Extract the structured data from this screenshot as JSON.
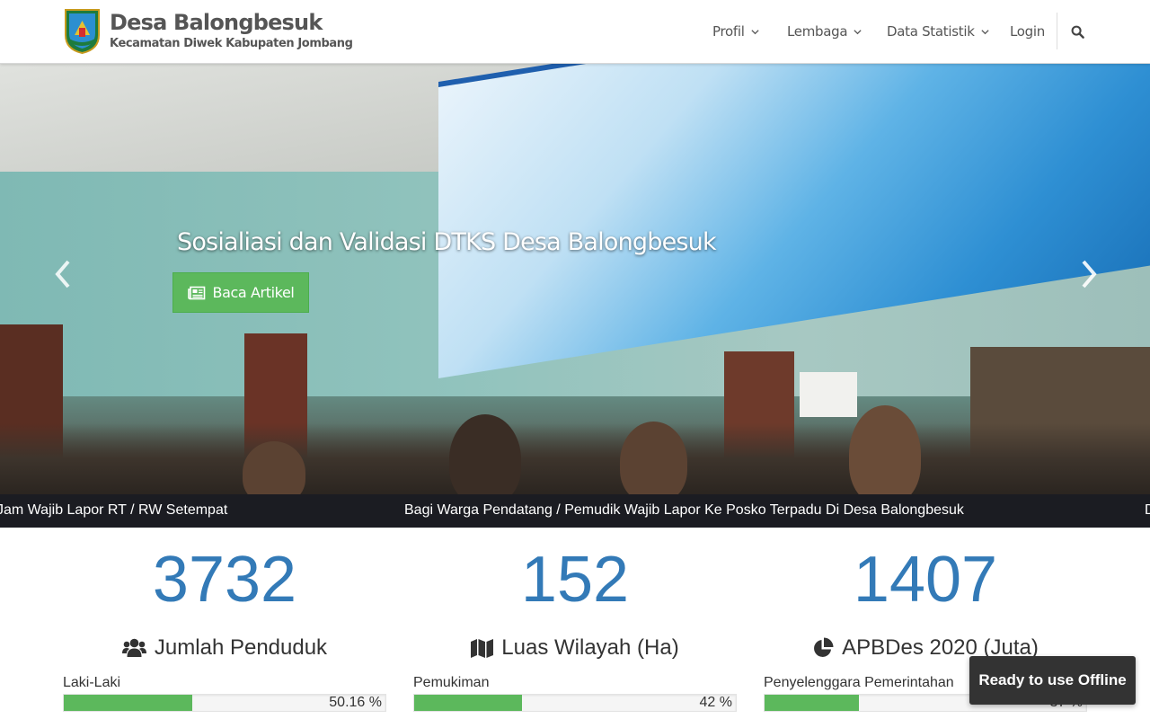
{
  "site": {
    "title": "Desa Balongbesuk",
    "subtitle": "Kecamatan Diwek Kabupaten Jombang",
    "logo_icon": "regency-shield-logo"
  },
  "nav": {
    "profil": "Profil",
    "lembaga": "Lembaga",
    "data_statistik": "Data Statistik",
    "login": "Login",
    "search_icon": "search-icon"
  },
  "hero": {
    "caption": "Sosialiasi dan Validasi DTKS Desa Balongbesuk",
    "button_label": "Baca Artikel",
    "button_icon": "newspaper-icon",
    "prev_icon": "chevron-left-icon",
    "next_icon": "chevron-right-icon"
  },
  "ticker": {
    "items": [
      "Jam Wajib Lapor RT / RW Setempat",
      "Bagi Warga Pendatang / Pemudik Wajib Lapor Ke Posko Terpadu Di Desa Balongbesuk",
      "D"
    ]
  },
  "stats": [
    {
      "value": "3732",
      "heading": "Jumlah Penduduk",
      "icon": "users-icon",
      "label": "Laki-Laki",
      "percent_text": "50.16 %",
      "percent": 40
    },
    {
      "value": "152",
      "heading": "Luas Wilayah (Ha)",
      "icon": "map-icon",
      "label": "Pemukiman",
      "percent_text": "42 %",
      "percent": 33.6
    },
    {
      "value": "1407",
      "heading": "APBDes 2020 (Juta)",
      "icon": "pie-chart-icon",
      "label": "Penyelenggara Pemerintahan",
      "percent_text": "37 %",
      "percent": 29.4
    }
  ],
  "offline_badge": "Ready to use Offline",
  "colors": {
    "accent": "#337ab7",
    "success": "#5cb85c",
    "ticker_bg": "#1b1c22"
  }
}
